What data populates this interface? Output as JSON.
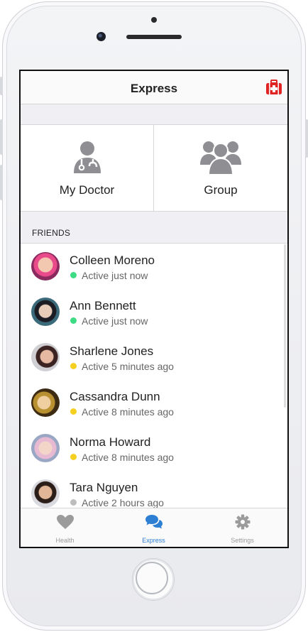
{
  "nav": {
    "title": "Express"
  },
  "tiles": [
    {
      "label": "My Doctor",
      "icon": "doctor-icon"
    },
    {
      "label": "Group",
      "icon": "group-icon"
    }
  ],
  "friends_section": {
    "title": "FRIENDS"
  },
  "friends": [
    {
      "name": "Colleen Moreno",
      "status": "Active just now",
      "status_color": "#3ddc84"
    },
    {
      "name": "Ann Bennett",
      "status": "Active just now",
      "status_color": "#3ddc84"
    },
    {
      "name": "Sharlene Jones",
      "status": "Active 5 minutes ago",
      "status_color": "#f5d020"
    },
    {
      "name": "Cassandra Dunn",
      "status": "Active 8 minutes ago",
      "status_color": "#f5d020"
    },
    {
      "name": "Norma Howard",
      "status": "Active 8 minutes ago",
      "status_color": "#f5d020"
    },
    {
      "name": "Tara Nguyen",
      "status": "Active 2 hours ago",
      "status_color": "#bdbdbd"
    }
  ],
  "tabs": [
    {
      "label": "Health",
      "icon": "heart-icon",
      "active": false
    },
    {
      "label": "Express",
      "icon": "chat-bubbles-icon",
      "active": true
    },
    {
      "label": "Settings",
      "icon": "gear-icon",
      "active": false
    }
  ],
  "colors": {
    "accent": "#2d7fd3",
    "inactive": "#9b9b9b",
    "emergency": "#e02424",
    "icon_gray": "#8e8e93"
  }
}
